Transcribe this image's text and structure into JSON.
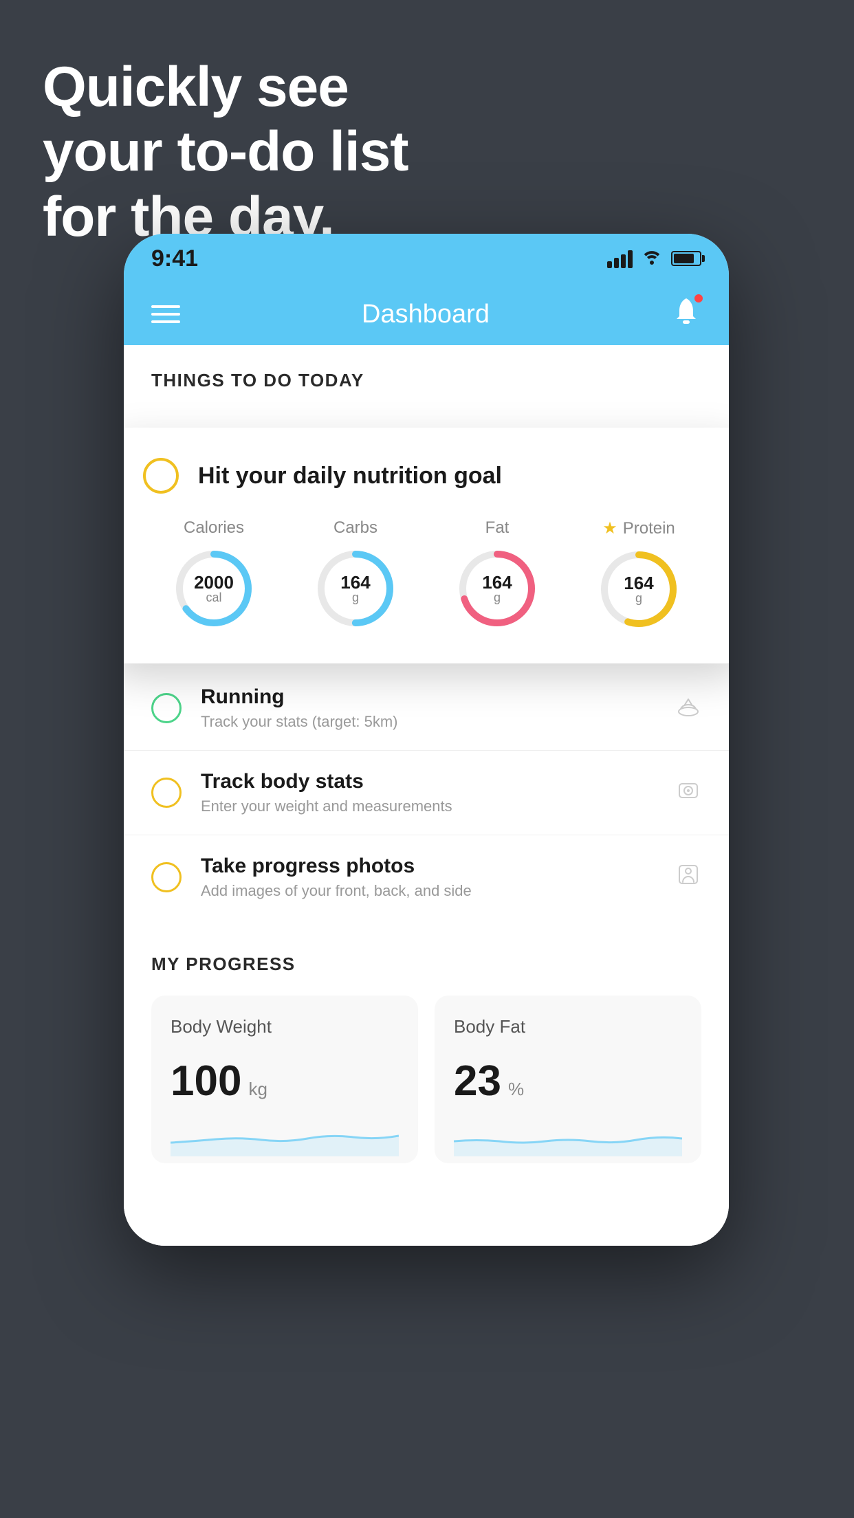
{
  "headline": {
    "line1": "Quickly see",
    "line2": "your to-do list",
    "line3": "for the day."
  },
  "statusBar": {
    "time": "9:41"
  },
  "navBar": {
    "title": "Dashboard"
  },
  "todaySection": {
    "header": "THINGS TO DO TODAY"
  },
  "nutritionCard": {
    "title": "Hit your daily nutrition goal",
    "calories": {
      "label": "Calories",
      "value": "2000",
      "unit": "cal",
      "color": "#5bc8f5",
      "trackColor": "#e8e8e8",
      "progress": 65
    },
    "carbs": {
      "label": "Carbs",
      "value": "164",
      "unit": "g",
      "color": "#5bc8f5",
      "trackColor": "#e8e8e8",
      "progress": 50
    },
    "fat": {
      "label": "Fat",
      "value": "164",
      "unit": "g",
      "color": "#f06080",
      "trackColor": "#e8e8e8",
      "progress": 70
    },
    "protein": {
      "label": "Protein",
      "value": "164",
      "unit": "g",
      "color": "#f0c020",
      "trackColor": "#e8e8e8",
      "progress": 55
    }
  },
  "listItems": [
    {
      "title": "Running",
      "subtitle": "Track your stats (target: 5km)",
      "circleColor": "green",
      "icon": "🏃"
    },
    {
      "title": "Track body stats",
      "subtitle": "Enter your weight and measurements",
      "circleColor": "yellow",
      "icon": "⚖"
    },
    {
      "title": "Take progress photos",
      "subtitle": "Add images of your front, back, and side",
      "circleColor": "yellow",
      "icon": "👤"
    }
  ],
  "progressSection": {
    "header": "MY PROGRESS",
    "bodyWeight": {
      "title": "Body Weight",
      "value": "100",
      "unit": "kg"
    },
    "bodyFat": {
      "title": "Body Fat",
      "value": "23",
      "unit": "%"
    }
  }
}
